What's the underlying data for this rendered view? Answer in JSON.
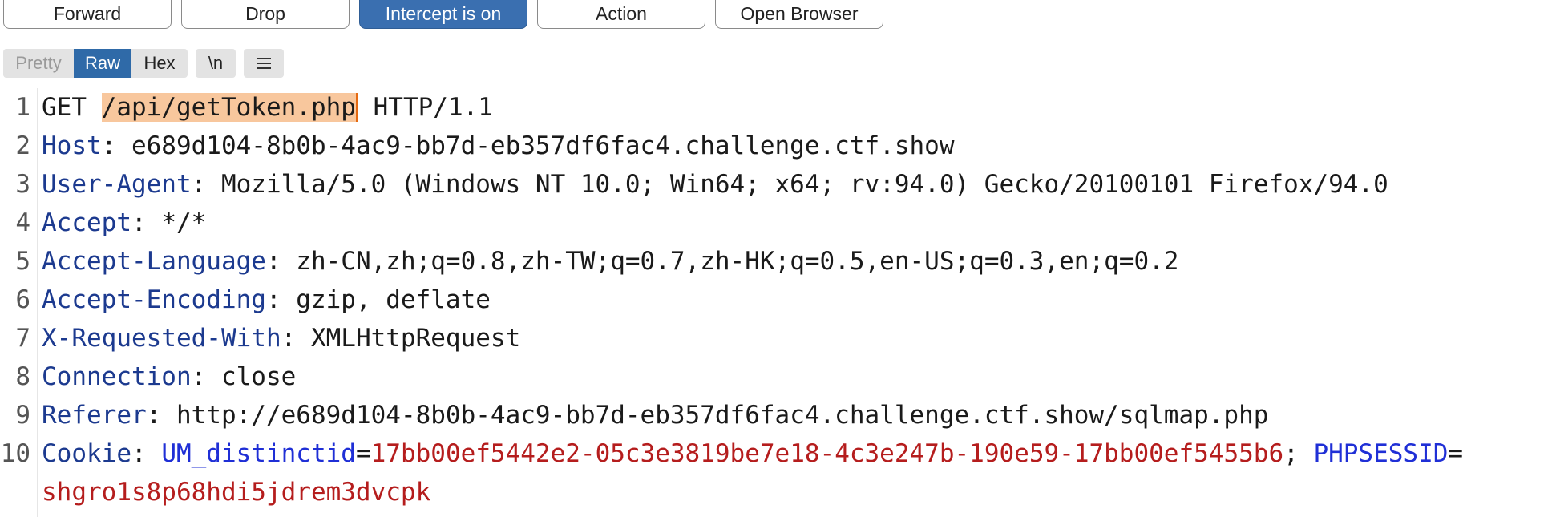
{
  "toolbar": {
    "buttons": [
      {
        "label": "Forward"
      },
      {
        "label": "Drop"
      },
      {
        "label": "Intercept is on"
      },
      {
        "label": "Action"
      },
      {
        "label": "Open Browser"
      }
    ]
  },
  "view": {
    "pretty": "Pretty",
    "raw": "Raw",
    "hex": "Hex",
    "newline": "\\n",
    "menu_icon": "hamburger-menu-icon"
  },
  "request": {
    "method": "GET",
    "path": "/api/getToken.php",
    "protocol": "HTTP/1.1",
    "headers": [
      {
        "num": "1"
      },
      {
        "num": "2",
        "name": "Host",
        "value": "e689d104-8b0b-4ac9-bb7d-eb357df6fac4.challenge.ctf.show"
      },
      {
        "num": "3",
        "name": "User-Agent",
        "value": "Mozilla/5.0 (Windows NT 10.0; Win64; x64; rv:94.0) Gecko/20100101 Firefox/94.0"
      },
      {
        "num": "4",
        "name": "Accept",
        "value": "*/*"
      },
      {
        "num": "5",
        "name": "Accept-Language",
        "value": "zh-CN,zh;q=0.8,zh-TW;q=0.7,zh-HK;q=0.5,en-US;q=0.3,en;q=0.2"
      },
      {
        "num": "6",
        "name": "Accept-Encoding",
        "value": "gzip, deflate"
      },
      {
        "num": "7",
        "name": "X-Requested-With",
        "value": "XMLHttpRequest"
      },
      {
        "num": "8",
        "name": "Connection",
        "value": "close"
      },
      {
        "num": "9",
        "name": "Referer",
        "value": "http://e689d104-8b0b-4ac9-bb7d-eb357df6fac4.challenge.ctf.show/sqlmap.php"
      },
      {
        "num": "10",
        "name": "Cookie"
      }
    ],
    "cookie": {
      "k1": "UM_distinctid",
      "v1": "17bb00ef5442e2-05c3e3819be7e18-4c3e247b-190e59-17bb00ef5455b6",
      "sep": "; ",
      "k2": "PHPSESSID",
      "v2": "shgro1s8p68hdi5jdrem3dvcpk"
    }
  }
}
